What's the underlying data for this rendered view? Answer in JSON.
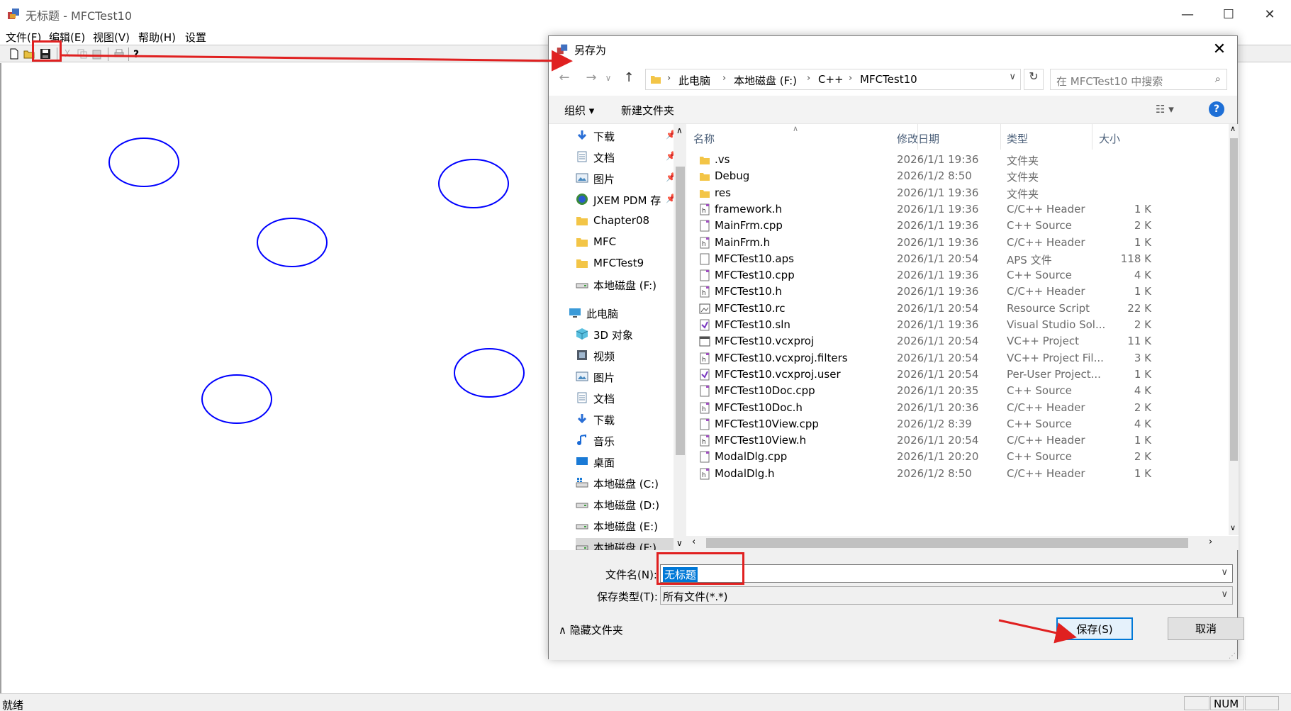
{
  "window": {
    "title": "无标题 - MFCTest10"
  },
  "menu": [
    "文件(F)",
    "编辑(E)",
    "视图(V)",
    "帮助(H)",
    "设置"
  ],
  "statusbar": {
    "text": "就绪",
    "num": "NUM"
  },
  "dialog": {
    "title": "另存为",
    "address": [
      "此电脑",
      "本地磁盘 (F:)",
      "C++",
      "MFCTest10"
    ],
    "search_placeholder": "在 MFCTest10 中搜索",
    "commands": {
      "organize": "组织 ▾",
      "new_folder": "新建文件夹"
    },
    "nav": {
      "quick": [
        {
          "label": "下载",
          "icon": "download-arrow-icon",
          "pinned": true
        },
        {
          "label": "文档",
          "icon": "document-icon",
          "pinned": true
        },
        {
          "label": "图片",
          "icon": "picture-icon",
          "pinned": true
        },
        {
          "label": "JXEM PDM 存",
          "icon": "globe-icon",
          "pinned": true
        },
        {
          "label": "Chapter08",
          "icon": "folder-icon",
          "pinned": false
        },
        {
          "label": "MFC",
          "icon": "folder-icon",
          "pinned": false
        },
        {
          "label": "MFCTest9",
          "icon": "folder-icon",
          "pinned": false
        },
        {
          "label": "本地磁盘 (F:)",
          "icon": "drive-icon",
          "pinned": false
        }
      ],
      "this_pc": "此电脑",
      "pc_items": [
        {
          "label": "3D 对象",
          "icon": "cube-icon"
        },
        {
          "label": "视频",
          "icon": "video-icon"
        },
        {
          "label": "图片",
          "icon": "picture-icon"
        },
        {
          "label": "文档",
          "icon": "document-icon"
        },
        {
          "label": "下载",
          "icon": "download-arrow-icon"
        },
        {
          "label": "音乐",
          "icon": "music-note-icon"
        },
        {
          "label": "桌面",
          "icon": "desktop-icon"
        },
        {
          "label": "本地磁盘 (C:)",
          "icon": "windows-drive-icon"
        },
        {
          "label": "本地磁盘 (D:)",
          "icon": "drive-icon"
        },
        {
          "label": "本地磁盘 (E:)",
          "icon": "drive-icon"
        },
        {
          "label": "本地磁盘 (F:)",
          "icon": "drive-icon"
        }
      ]
    },
    "columns": [
      "名称",
      "修改日期",
      "类型",
      "大小"
    ],
    "files": [
      {
        "name": ".vs",
        "date": "2026/1/1 19:36",
        "type": "文件夹",
        "size": "",
        "kind": "folder"
      },
      {
        "name": "Debug",
        "date": "2026/1/2 8:50",
        "type": "文件夹",
        "size": "",
        "kind": "folder"
      },
      {
        "name": "res",
        "date": "2026/1/1 19:36",
        "type": "文件夹",
        "size": "",
        "kind": "folder"
      },
      {
        "name": "framework.h",
        "date": "2026/1/1 19:36",
        "type": "C/C++ Header",
        "size": "1 K",
        "kind": "header"
      },
      {
        "name": "MainFrm.cpp",
        "date": "2026/1/1 19:36",
        "type": "C++ Source",
        "size": "2 K",
        "kind": "source"
      },
      {
        "name": "MainFrm.h",
        "date": "2026/1/1 19:36",
        "type": "C/C++ Header",
        "size": "1 K",
        "kind": "header"
      },
      {
        "name": "MFCTest10.aps",
        "date": "2026/1/1 20:54",
        "type": "APS 文件",
        "size": "118 K",
        "kind": "file"
      },
      {
        "name": "MFCTest10.cpp",
        "date": "2026/1/1 19:36",
        "type": "C++ Source",
        "size": "4 K",
        "kind": "source"
      },
      {
        "name": "MFCTest10.h",
        "date": "2026/1/1 19:36",
        "type": "C/C++ Header",
        "size": "1 K",
        "kind": "header"
      },
      {
        "name": "MFCTest10.rc",
        "date": "2026/1/1 20:54",
        "type": "Resource Script",
        "size": "22 K",
        "kind": "rc"
      },
      {
        "name": "MFCTest10.sln",
        "date": "2026/1/1 19:36",
        "type": "Visual Studio Sol...",
        "size": "2 K",
        "kind": "sln"
      },
      {
        "name": "MFCTest10.vcxproj",
        "date": "2026/1/1 20:54",
        "type": "VC++ Project",
        "size": "11 K",
        "kind": "proj"
      },
      {
        "name": "MFCTest10.vcxproj.filters",
        "date": "2026/1/1 20:54",
        "type": "VC++ Project Fil...",
        "size": "3 K",
        "kind": "header"
      },
      {
        "name": "MFCTest10.vcxproj.user",
        "date": "2026/1/1 20:54",
        "type": "Per-User Project...",
        "size": "1 K",
        "kind": "sln"
      },
      {
        "name": "MFCTest10Doc.cpp",
        "date": "2026/1/1 20:35",
        "type": "C++ Source",
        "size": "4 K",
        "kind": "source"
      },
      {
        "name": "MFCTest10Doc.h",
        "date": "2026/1/1 20:36",
        "type": "C/C++ Header",
        "size": "2 K",
        "kind": "header"
      },
      {
        "name": "MFCTest10View.cpp",
        "date": "2026/1/2 8:39",
        "type": "C++ Source",
        "size": "4 K",
        "kind": "source"
      },
      {
        "name": "MFCTest10View.h",
        "date": "2026/1/1 20:54",
        "type": "C/C++ Header",
        "size": "1 K",
        "kind": "header"
      },
      {
        "name": "ModalDlg.cpp",
        "date": "2026/1/1 20:20",
        "type": "C++ Source",
        "size": "2 K",
        "kind": "source"
      },
      {
        "name": "ModalDlg.h",
        "date": "2026/1/2 8:50",
        "type": "C/C++ Header",
        "size": "1 K",
        "kind": "header"
      }
    ],
    "filename_label": "文件名(N):",
    "filename_value": "无标题",
    "filetype_label": "保存类型(T):",
    "filetype_value": "所有文件(*.*)",
    "hide_folders": "隐藏文件夹",
    "save_button": "保存(S)",
    "cancel_button": "取消"
  },
  "colors": {
    "ellipse": "#0000ff",
    "annotation": "#e02020",
    "accent": "#0078d7"
  }
}
